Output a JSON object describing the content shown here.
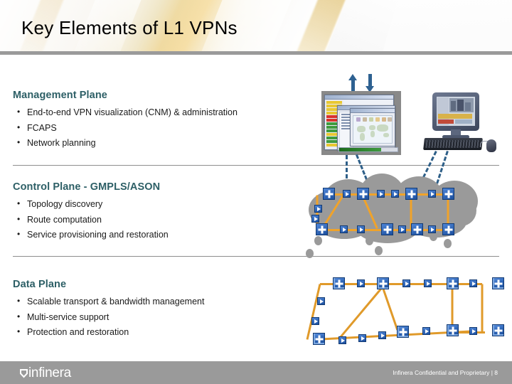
{
  "header": {
    "title": "Key Elements of L1 VPNs"
  },
  "sections": [
    {
      "heading": "Management Plane",
      "bullets": [
        "End-to-end VPN visualization (CNM) & administration",
        "FCAPS",
        "Network planning"
      ]
    },
    {
      "heading": "Control Plane - GMPLS/ASON",
      "bullets": [
        "Topology discovery",
        "Route computation",
        "Service provisioning and restoration"
      ]
    },
    {
      "heading": "Data Plane",
      "bullets": [
        "Scalable transport & bandwidth management",
        "Multi-service support",
        "Protection and restoration"
      ]
    }
  ],
  "graphics": {
    "management": {
      "uplink_arrow": "arrow-up-icon",
      "downlink_arrow": "arrow-down-icon",
      "nms_screenshot": "network-management-app-screenshot",
      "workstation": "computer-monitor-keyboard-mouse"
    },
    "control_plane": {
      "cloud": "network-cloud-shape",
      "node_icon": "router-node-icon",
      "link_icon": "link-arrow-icon"
    },
    "data_plane": {
      "node_icon": "switch-cube-node-icon",
      "link_icon": "link-arrow-icon"
    }
  },
  "footer": {
    "logo_text": "infinera",
    "logo_mark": "infinera-shield-icon",
    "confidential": "Infinera Confidential and Proprietary  |  8"
  },
  "colors": {
    "heading": "#2d5f66",
    "body_text": "#1a1a1a",
    "footer_bar": "#9a9a9a",
    "header_rule": "#9a9a9a",
    "link_orange": "#f0a32a",
    "node_blue": "#1b4f9e",
    "cloud_gray": "#9a9a9a",
    "dash_blue": "#2e5f88"
  }
}
